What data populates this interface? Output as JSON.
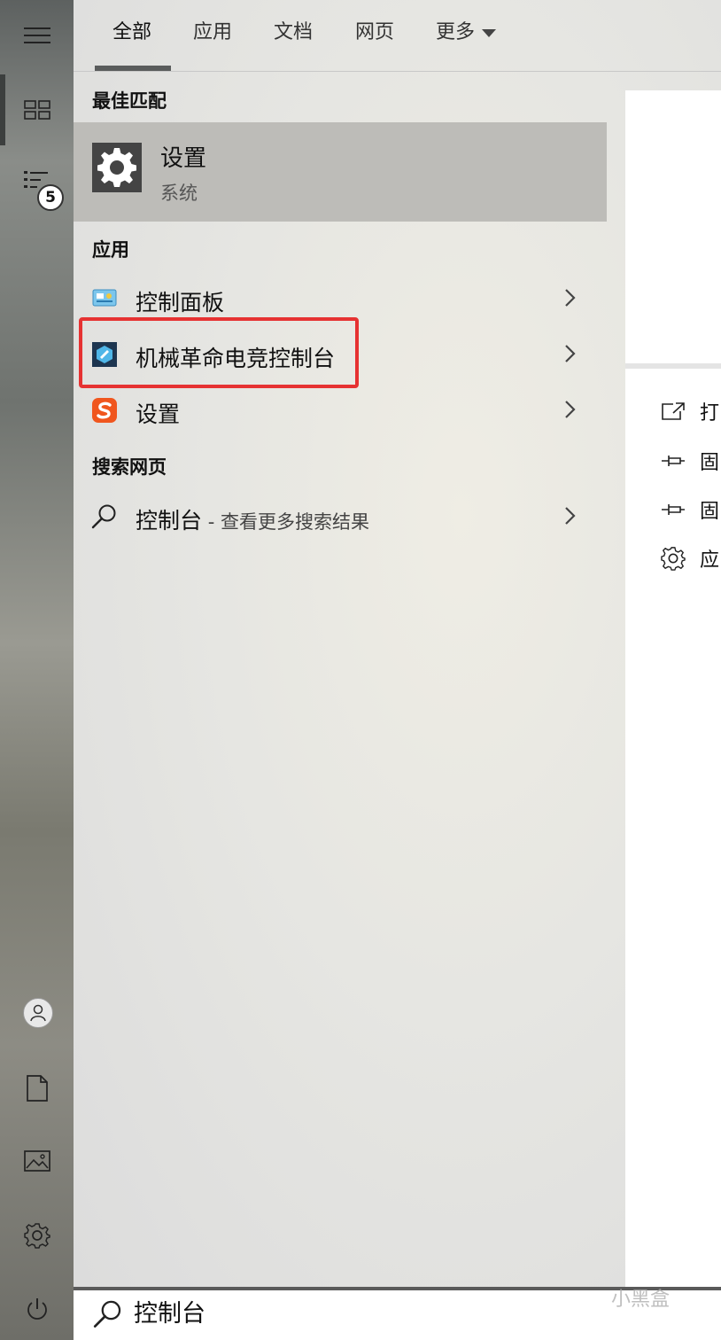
{
  "rail": {
    "badge_count": "5"
  },
  "tabs": [
    {
      "label": "全部"
    },
    {
      "label": "应用"
    },
    {
      "label": "文档"
    },
    {
      "label": "网页"
    },
    {
      "label": "更多"
    }
  ],
  "best_match": {
    "heading": "最佳匹配",
    "title": "设置",
    "subtitle": "系统"
  },
  "apps": {
    "heading": "应用",
    "items": [
      {
        "label": "控制面板",
        "icon": "control-panel-icon"
      },
      {
        "label": "机械革命电竞控制台",
        "icon": "mechrevo-icon"
      },
      {
        "label": "设置",
        "icon": "sogou-icon"
      }
    ]
  },
  "web": {
    "heading": "搜索网页",
    "query": "控制台",
    "suffix": " - 查看更多搜索结果"
  },
  "preview": {
    "actions": [
      {
        "label": "打",
        "icon": "open-icon"
      },
      {
        "label": "固",
        "icon": "pin-icon"
      },
      {
        "label": "固",
        "icon": "pin-icon"
      },
      {
        "label": "应",
        "icon": "gear-icon"
      }
    ]
  },
  "search": {
    "value": "控制台"
  },
  "watermark": "小黑盒"
}
